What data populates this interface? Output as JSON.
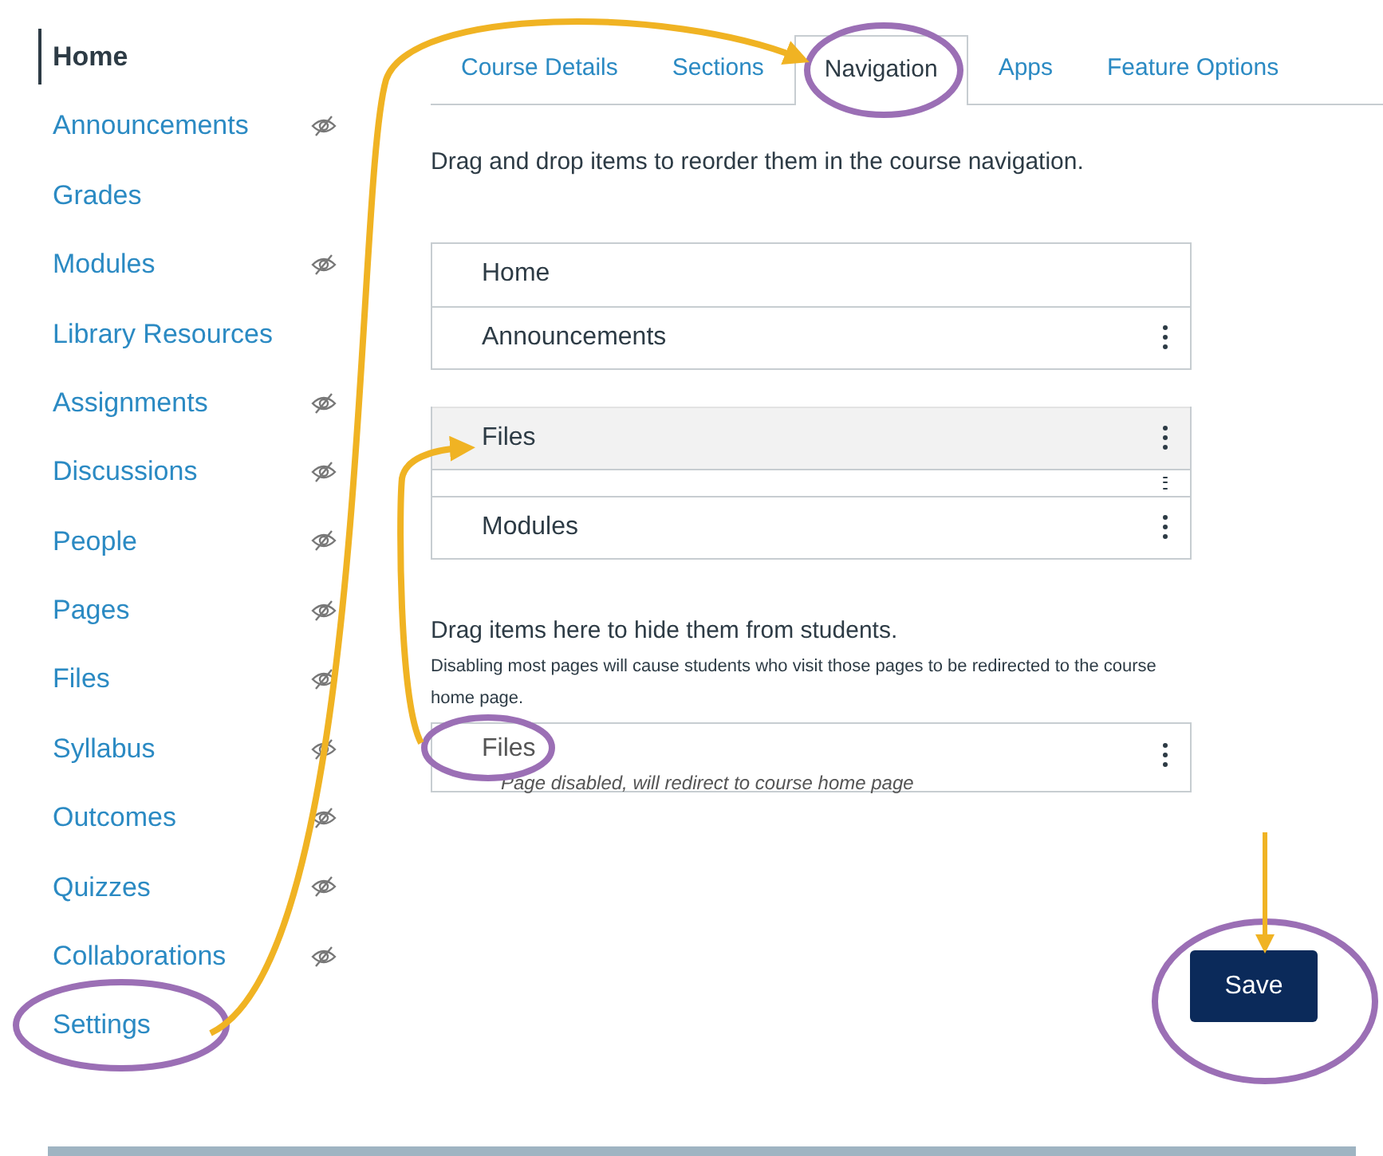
{
  "sidebar": {
    "items": [
      {
        "label": "Home",
        "selected": true,
        "hidden": false
      },
      {
        "label": "Announcements",
        "selected": false,
        "hidden": true
      },
      {
        "label": "Grades",
        "selected": false,
        "hidden": false
      },
      {
        "label": "Modules",
        "selected": false,
        "hidden": true
      },
      {
        "label": "Library Resources",
        "selected": false,
        "hidden": false
      },
      {
        "label": "Assignments",
        "selected": false,
        "hidden": true
      },
      {
        "label": "Discussions",
        "selected": false,
        "hidden": true
      },
      {
        "label": "People",
        "selected": false,
        "hidden": true
      },
      {
        "label": "Pages",
        "selected": false,
        "hidden": true
      },
      {
        "label": "Files",
        "selected": false,
        "hidden": true
      },
      {
        "label": "Syllabus",
        "selected": false,
        "hidden": true
      },
      {
        "label": "Outcomes",
        "selected": false,
        "hidden": true
      },
      {
        "label": "Quizzes",
        "selected": false,
        "hidden": true
      },
      {
        "label": "Collaborations",
        "selected": false,
        "hidden": true
      },
      {
        "label": "Settings",
        "selected": false,
        "hidden": false
      }
    ]
  },
  "tabs": [
    {
      "label": "Course Details",
      "selected": false
    },
    {
      "label": "Sections",
      "selected": false
    },
    {
      "label": "Navigation",
      "selected": true
    },
    {
      "label": "Apps",
      "selected": false
    },
    {
      "label": "Feature Options",
      "selected": false
    }
  ],
  "enabled": {
    "instruction": "Drag and drop items to reorder them in the course navigation.",
    "groups": [
      [
        {
          "kind": "item",
          "label": "Home",
          "menu": false
        },
        {
          "kind": "item",
          "label": "Announcements",
          "menu": true
        }
      ],
      [
        {
          "kind": "dragging",
          "label": "Files",
          "menu": true
        },
        {
          "kind": "occluded",
          "menu": true
        },
        {
          "kind": "item",
          "label": "Modules",
          "menu": true
        }
      ]
    ]
  },
  "hidden": {
    "instruction": "Drag items here to hide them from students.",
    "note": "Disabling most pages will cause students who visit those pages to be redirected to the course home page.",
    "items": [
      {
        "label": "Files",
        "detail": "Page disabled, will redirect to course home page",
        "menu": true
      }
    ]
  },
  "save_button": "Save"
}
